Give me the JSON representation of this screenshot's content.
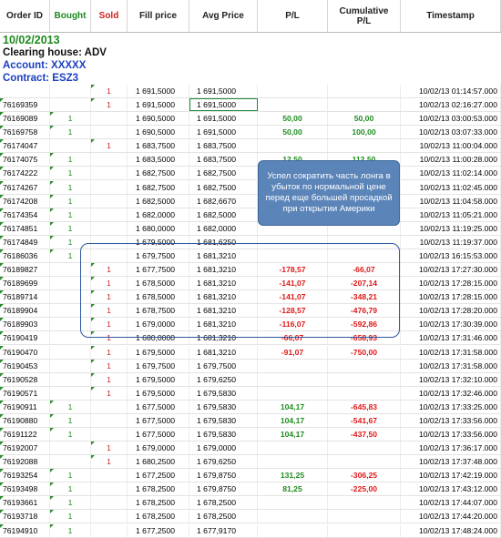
{
  "headers": {
    "order_id": "Order ID",
    "bought": "Bought",
    "sold": "Sold",
    "fill_price": "Fill price",
    "avg_price": "Avg Price",
    "pl": "P/L",
    "cumulative_pl": "Cumulative P/L",
    "timestamp": "Timestamp"
  },
  "info": {
    "date": "10/02/2013",
    "clearing_house": "Clearing house: ADV",
    "account": "Account: XXXXX",
    "contract": "Contract: ESZ3"
  },
  "callout": "Успел сократить часть лонга в убыток по нормальной цене перед еще большей просадкой при открытии Америки",
  "rows": [
    {
      "id": "",
      "b": "",
      "s": "1",
      "fill": "1 691,5000",
      "avg": "1 691,5000",
      "pl": "",
      "cpl": "",
      "ts": "10/02/13 01:14:57.000"
    },
    {
      "id": "76169359",
      "b": "",
      "s": "1",
      "fill": "1 691,5000",
      "avg": "1 691,5000",
      "pl": "",
      "cpl": "",
      "ts": "10/02/13 02:16:27.000"
    },
    {
      "id": "76169089",
      "b": "1",
      "s": "",
      "fill": "1 690,5000",
      "avg": "1 691,5000",
      "pl": "50,00",
      "cpl": "50,00",
      "ts": "10/02/13 03:00:53.000"
    },
    {
      "id": "76169758",
      "b": "1",
      "s": "",
      "fill": "1 690,5000",
      "avg": "1 691,5000",
      "pl": "50,00",
      "cpl": "100,00",
      "ts": "10/02/13 03:07:33.000"
    },
    {
      "id": "76174047",
      "b": "",
      "s": "1",
      "fill": "1 683,7500",
      "avg": "1 683,7500",
      "pl": "",
      "cpl": "",
      "ts": "10/02/13 11:00:04.000"
    },
    {
      "id": "76174075",
      "b": "1",
      "s": "",
      "fill": "1 683,5000",
      "avg": "1 683,7500",
      "pl": "12,50",
      "cpl": "112,50",
      "ts": "10/02/13 11:00:28.000"
    },
    {
      "id": "76174222",
      "b": "1",
      "s": "",
      "fill": "1 682,7500",
      "avg": "1 682,7500",
      "pl": "",
      "cpl": "",
      "ts": "10/02/13 11:02:14.000"
    },
    {
      "id": "76174267",
      "b": "1",
      "s": "",
      "fill": "1 682,7500",
      "avg": "1 682,7500",
      "pl": "",
      "cpl": "",
      "ts": "10/02/13 11:02:45.000"
    },
    {
      "id": "76174208",
      "b": "1",
      "s": "",
      "fill": "1 682,5000",
      "avg": "1 682,6670",
      "pl": "",
      "cpl": "",
      "ts": "10/02/13 11:04:58.000"
    },
    {
      "id": "76174354",
      "b": "1",
      "s": "",
      "fill": "1 682,0000",
      "avg": "1 682,5000",
      "pl": "",
      "cpl": "",
      "ts": "10/02/13 11:05:21.000"
    },
    {
      "id": "76174851",
      "b": "1",
      "s": "",
      "fill": "1 680,0000",
      "avg": "1 682,0000",
      "pl": "",
      "cpl": "",
      "ts": "10/02/13 11:19:25.000"
    },
    {
      "id": "76174849",
      "b": "1",
      "s": "",
      "fill": "1 679,5000",
      "avg": "1 681,6250",
      "pl": "",
      "cpl": "",
      "ts": "10/02/13 11:19:37.000"
    },
    {
      "id": "76186036",
      "b": "1",
      "s": "",
      "fill": "1 679,7500",
      "avg": "1 681,3210",
      "pl": "",
      "cpl": "",
      "ts": "10/02/13 16:15:53.000"
    },
    {
      "id": "76189827",
      "b": "",
      "s": "1",
      "fill": "1 677,7500",
      "avg": "1 681,3210",
      "pl": "-178,57",
      "cpl": "-66,07",
      "ts": "10/02/13 17:27:30.000"
    },
    {
      "id": "76189699",
      "b": "",
      "s": "1",
      "fill": "1 678,5000",
      "avg": "1 681,3210",
      "pl": "-141,07",
      "cpl": "-207,14",
      "ts": "10/02/13 17:28:15.000"
    },
    {
      "id": "76189714",
      "b": "",
      "s": "1",
      "fill": "1 678,5000",
      "avg": "1 681,3210",
      "pl": "-141,07",
      "cpl": "-348,21",
      "ts": "10/02/13 17:28:15.000"
    },
    {
      "id": "76189904",
      "b": "",
      "s": "1",
      "fill": "1 678,7500",
      "avg": "1 681,3210",
      "pl": "-128,57",
      "cpl": "-476,79",
      "ts": "10/02/13 17:28:20.000"
    },
    {
      "id": "76189903",
      "b": "",
      "s": "1",
      "fill": "1 679,0000",
      "avg": "1 681,3210",
      "pl": "-116,07",
      "cpl": "-592,86",
      "ts": "10/02/13 17:30:39.000"
    },
    {
      "id": "76190419",
      "b": "",
      "s": "1",
      "fill": "1 680,0000",
      "avg": "1 681,3210",
      "pl": "-66,07",
      "cpl": "-658,93",
      "ts": "10/02/13 17:31:46.000"
    },
    {
      "id": "76190470",
      "b": "",
      "s": "1",
      "fill": "1 679,5000",
      "avg": "1 681,3210",
      "pl": "-91,07",
      "cpl": "-750,00",
      "ts": "10/02/13 17:31:58.000"
    },
    {
      "id": "76190453",
      "b": "",
      "s": "1",
      "fill": "1 679,7500",
      "avg": "1 679,7500",
      "pl": "",
      "cpl": "",
      "ts": "10/02/13 17:31:58.000"
    },
    {
      "id": "76190528",
      "b": "",
      "s": "1",
      "fill": "1 679,5000",
      "avg": "1 679,6250",
      "pl": "",
      "cpl": "",
      "ts": "10/02/13 17:32:10.000"
    },
    {
      "id": "76190571",
      "b": "",
      "s": "1",
      "fill": "1 679,5000",
      "avg": "1 679,5830",
      "pl": "",
      "cpl": "",
      "ts": "10/02/13 17:32:46.000"
    },
    {
      "id": "76190911",
      "b": "1",
      "s": "",
      "fill": "1 677,5000",
      "avg": "1 679,5830",
      "pl": "104,17",
      "cpl": "-645,83",
      "ts": "10/02/13 17:33:25.000"
    },
    {
      "id": "76190880",
      "b": "1",
      "s": "",
      "fill": "1 677,5000",
      "avg": "1 679,5830",
      "pl": "104,17",
      "cpl": "-541,67",
      "ts": "10/02/13 17:33:56.000"
    },
    {
      "id": "76191122",
      "b": "1",
      "s": "",
      "fill": "1 677,5000",
      "avg": "1 679,5830",
      "pl": "104,17",
      "cpl": "-437,50",
      "ts": "10/02/13 17:33:56.000"
    },
    {
      "id": "76192007",
      "b": "",
      "s": "1",
      "fill": "1 679,0000",
      "avg": "1 679,0000",
      "pl": "",
      "cpl": "",
      "ts": "10/02/13 17:36:17.000"
    },
    {
      "id": "76192088",
      "b": "",
      "s": "1",
      "fill": "1 680,2500",
      "avg": "1 679,6250",
      "pl": "",
      "cpl": "",
      "ts": "10/02/13 17:37:48.000"
    },
    {
      "id": "76193254",
      "b": "1",
      "s": "",
      "fill": "1 677,2500",
      "avg": "1 679,8750",
      "pl": "131,25",
      "cpl": "-306,25",
      "ts": "10/02/13 17:42:19.000"
    },
    {
      "id": "76193498",
      "b": "1",
      "s": "",
      "fill": "1 678,2500",
      "avg": "1 679,8750",
      "pl": "81,25",
      "cpl": "-225,00",
      "ts": "10/02/13 17:43:12.000"
    },
    {
      "id": "76193661",
      "b": "1",
      "s": "",
      "fill": "1 678,2500",
      "avg": "1 678,2500",
      "pl": "",
      "cpl": "",
      "ts": "10/02/13 17:44:07.000"
    },
    {
      "id": "76193718",
      "b": "1",
      "s": "",
      "fill": "1 678,2500",
      "avg": "1 678,2500",
      "pl": "",
      "cpl": "",
      "ts": "10/02/13 17:44:20.000"
    },
    {
      "id": "76194910",
      "b": "1",
      "s": "",
      "fill": "1 677,2500",
      "avg": "1 677,9170",
      "pl": "",
      "cpl": "",
      "ts": "10/02/13 17:48:24.000"
    }
  ]
}
